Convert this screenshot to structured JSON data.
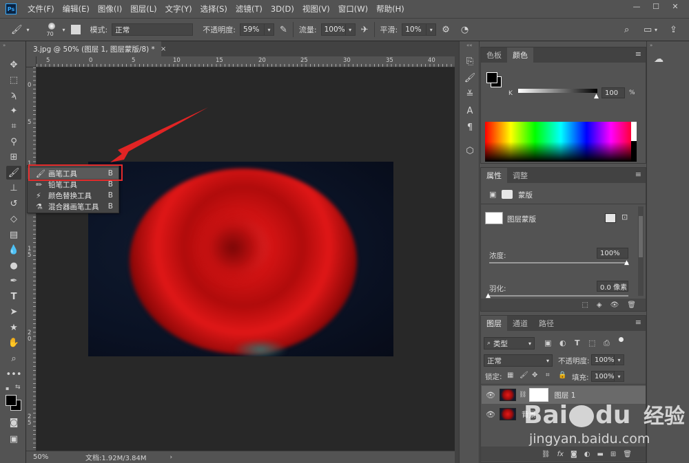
{
  "menubar": {
    "logo": "Ps",
    "items": [
      "文件(F)",
      "编辑(E)",
      "图像(I)",
      "图层(L)",
      "文字(Y)",
      "选择(S)",
      "滤镜(T)",
      "3D(D)",
      "视图(V)",
      "窗口(W)",
      "帮助(H)"
    ],
    "window_controls": [
      "—",
      "☐",
      "✕"
    ]
  },
  "options": {
    "brush_size": "70",
    "mode_label": "模式:",
    "mode_value": "正常",
    "opacity_label": "不透明度:",
    "opacity_value": "59%",
    "flow_label": "流量:",
    "flow_value": "100%",
    "smoothing_label": "平滑:",
    "smoothing_value": "10%"
  },
  "document": {
    "tab_title": "3.jpg @ 50% (图层 1, 图层蒙版/8) *",
    "tab_close": "×",
    "zoom": "50%",
    "doc_info": "文档:1.92M/3.84M",
    "ruler_top": [
      "5",
      "0",
      "5",
      "10",
      "15",
      "20",
      "25",
      "30",
      "35",
      "40"
    ],
    "ruler_left": [
      "0",
      "5",
      "1 0",
      "1 5",
      "2 0",
      "2 5"
    ]
  },
  "flyout": {
    "items": [
      {
        "label": "画笔工具",
        "key": "B",
        "icon": "brush-icon"
      },
      {
        "label": "铅笔工具",
        "key": "B",
        "icon": "pencil-icon"
      },
      {
        "label": "颜色替换工具",
        "key": "B",
        "icon": "color-replace-icon"
      },
      {
        "label": "混合器画笔工具",
        "key": "B",
        "icon": "mixer-brush-icon"
      }
    ]
  },
  "color_panel": {
    "tabs": [
      "色板",
      "颜色"
    ],
    "channel_label": "K",
    "k_value": "100",
    "unit": "%"
  },
  "properties_panel": {
    "tabs": [
      "属性",
      "调整"
    ],
    "mask_header": "蒙版",
    "layer_mask_label": "图层蒙版",
    "density_label": "浓度:",
    "density_value": "100%",
    "feather_label": "羽化:",
    "feather_value": "0.0 像素"
  },
  "layers_panel": {
    "tabs": [
      "图层",
      "通道",
      "路径"
    ],
    "filter_label": "类型",
    "blend_mode": "正常",
    "opacity_label": "不透明度:",
    "opacity_value": "100%",
    "lock_label": "锁定:",
    "fill_label": "填充:",
    "fill_value": "100%",
    "layers": [
      {
        "name": "图层 1"
      },
      {
        "name": "背景"
      }
    ]
  },
  "watermark": {
    "brand": "Bai",
    "brand2": "du",
    "brand_cn": "经验",
    "url": "jingyan.baidu.com"
  }
}
